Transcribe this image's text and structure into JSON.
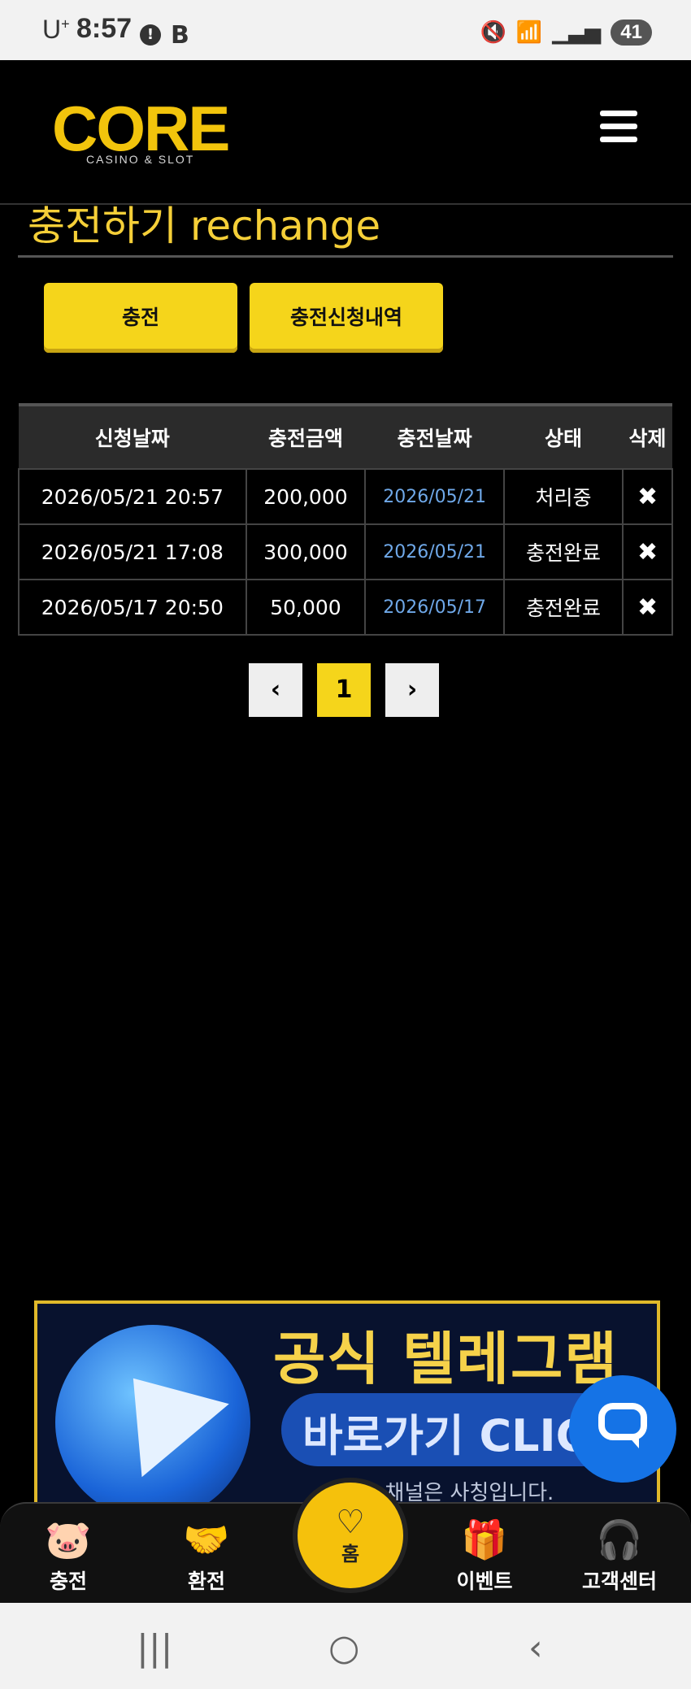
{
  "status_bar": {
    "carrier": "U",
    "carrier_sup": "+",
    "time": "8:57",
    "alert": "!",
    "b_icon": "B",
    "battery": "41",
    "mute_icon": "mute-icon",
    "wifi_icon": "wifi-icon",
    "signal_icon": "signal-icon"
  },
  "header": {
    "logo": "CORE",
    "logo_sub": "CASINO & SLOT"
  },
  "page": {
    "title": "충전하기 rechange"
  },
  "tabs": {
    "charge": "충전",
    "history": "충전신청내역"
  },
  "table": {
    "headers": [
      "신청날짜",
      "충전금액",
      "충전날짜",
      "상태",
      "삭제"
    ],
    "rows": [
      {
        "request_date": "2026/05/21 20:57",
        "amount": "200,000",
        "charge_date": "2026/05/21",
        "status": "처리중",
        "delete": "✖"
      },
      {
        "request_date": "2026/05/21 17:08",
        "amount": "300,000",
        "charge_date": "2026/05/21",
        "status": "충전완료",
        "delete": "✖"
      },
      {
        "request_date": "2026/05/17 20:50",
        "amount": "50,000",
        "charge_date": "2026/05/17",
        "status": "충전완료",
        "delete": "✖"
      }
    ]
  },
  "pagination": {
    "prev": "‹",
    "current": "1",
    "next": "›"
  },
  "banner": {
    "title": "공식 텔레그램",
    "subtitle": "바로가기 CLIC",
    "note": "...인 봇, 채널은 사칭입니다."
  },
  "bottom_nav": {
    "charge": "충전",
    "exchange": "환전",
    "home": "홈",
    "event": "이벤트",
    "support": "고객센터"
  },
  "system_nav": {
    "recent": "|||",
    "home": "○",
    "back": "‹"
  },
  "colors": {
    "accent": "#f5d51b",
    "background": "#000000",
    "link_blue": "#6fa8e8"
  }
}
